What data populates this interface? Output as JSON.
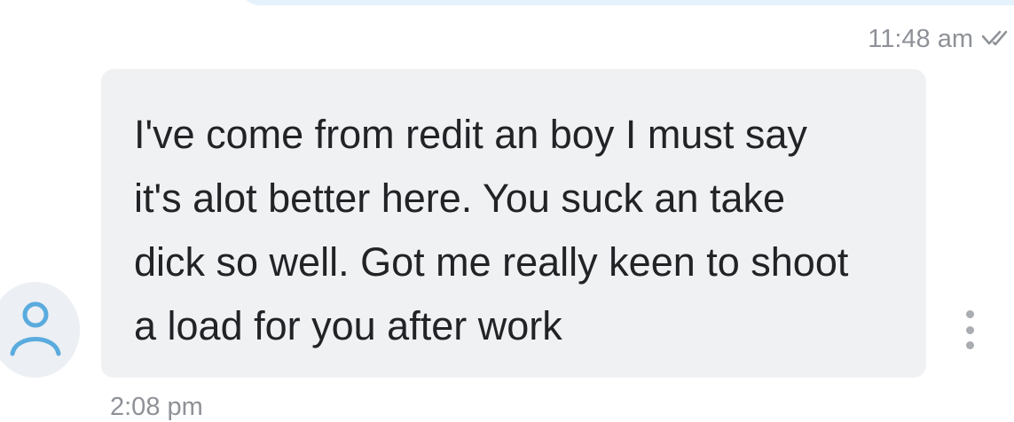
{
  "sent_message": {
    "time": "11:48 am",
    "status_icon": "double-check-read-icon"
  },
  "received_message": {
    "avatar_icon": "person-icon",
    "text": "I've come from redit an boy I must say\nit's alot better here. You suck an take\ndick so well. Got me really keen to shoot\na load for you after work",
    "time": "2:08 pm",
    "options_icon": "more-vertical-icon"
  },
  "colors": {
    "avatar_stroke": "#5aabde",
    "received_bubble": "#f0f1f3",
    "sent_bubble": "#e4f2fb",
    "timestamp": "#8e9197"
  }
}
